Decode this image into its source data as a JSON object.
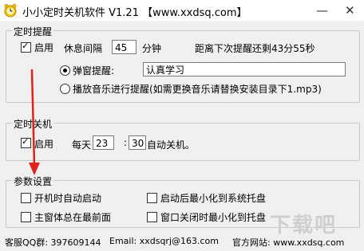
{
  "window": {
    "title": "小小定时关机软件 V1.21 【www.xxdsq.com】",
    "icon": "clock-icon",
    "minimize_label": "—",
    "close_label": "✕"
  },
  "reminder": {
    "legend": "定时提醒",
    "enable_label": "启用",
    "enable_checked": true,
    "interval_label": "休息间隔",
    "interval_value": "45",
    "interval_unit": "分钟",
    "countdown_text": "距离下次提醒还剩43分55秒",
    "popup_label": "弹窗提醒:",
    "popup_selected": true,
    "popup_value": "认真学习",
    "music_label": "播放音乐进行提醒(如需更换音乐请替换安装目录下1.mp3)",
    "music_selected": false
  },
  "shutdown": {
    "legend": "定时关机",
    "enable_label": "启用",
    "enable_checked": true,
    "daily_label": "每天",
    "hour_value": "23",
    "separator": ":",
    "minute_value": "30",
    "suffix_label": "自动关机。"
  },
  "settings": {
    "legend": "参数设置",
    "autostart_label": "开机时自动启动",
    "autostart_checked": false,
    "minimize_tray_label": "启动后最小化到系统托盘",
    "minimize_tray_checked": false,
    "topmost_label": "主窗体总在最前面",
    "topmost_checked": false,
    "close_tray_label": "窗口关闭时最小化到托盘",
    "close_tray_checked": false
  },
  "footer": {
    "qq_group": "客服QQ群: 397609144",
    "email": "Email: xxdsqrj@163.com",
    "website": "官方网站: www.xxdsq.com"
  },
  "watermark": "下载吧",
  "colors": {
    "annotation_arrow": "#e0241b",
    "title_bg": "#ffffff",
    "window_bg": "#f0f0f0"
  }
}
